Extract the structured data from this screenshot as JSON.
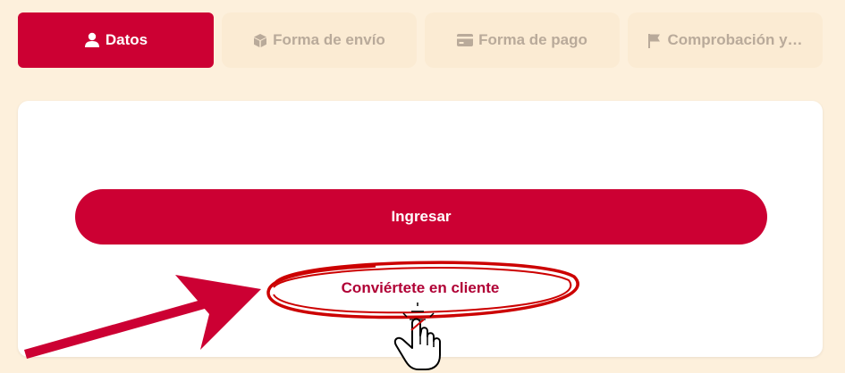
{
  "tabs": [
    {
      "label": "Datos",
      "icon": "user-icon",
      "active": true
    },
    {
      "label": "Forma de envío",
      "icon": "box-icon",
      "active": false
    },
    {
      "label": "Forma de pago",
      "icon": "credit-card-icon",
      "active": false
    },
    {
      "label": "Comprobación y…",
      "icon": "flag-icon",
      "active": false
    }
  ],
  "login": {
    "button_label": "Ingresar"
  },
  "register": {
    "link_label": "Conviértete en cliente"
  },
  "colors": {
    "accent": "#cc0033",
    "background": "#fdf0dc",
    "inactive_tab": "#fbebd3",
    "inactive_text": "#b9aa9a"
  }
}
